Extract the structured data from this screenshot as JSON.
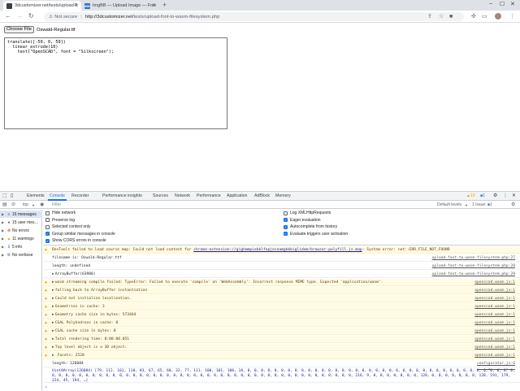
{
  "browser": {
    "tabs": [
      {
        "title": "3dcustomizer.net/tests/upload-font",
        "favicon_color": "#3c4043",
        "fav_text": ""
      },
      {
        "title": "ImgBB — Upload Image — Free",
        "favicon_color": "#2a73c8",
        "fav_text": "IBB"
      }
    ],
    "new_tab": "+",
    "url_warning": "Not secure",
    "url_host": "http://3dcustomizer.net",
    "url_path": "/tests/upload-font-to-wasm-filesystem.php"
  },
  "page": {
    "choose_button": "Choose File",
    "chosen_file": "Oswald-Regular.ttf",
    "code": "translate([-50, 0, 50])\n  linear_extrude(10)\n    text(\"OpenSCAD\", font = \"Silkscreen\");"
  },
  "devtools": {
    "tabs": [
      "Elements",
      "Console",
      "Recorder",
      "Performance insights",
      "Sources",
      "Network",
      "Performance",
      "Application",
      "AdBlock",
      "Memory"
    ],
    "active_tab": "Console",
    "warning_count": "10",
    "info_count": "1",
    "top_context": "top",
    "filter_placeholder": "Filter",
    "default_levels": "Default levels",
    "issues": "1 Issue:",
    "issues_count": "1",
    "sidebar": [
      {
        "label": "16 messages",
        "icon": "≡",
        "color": "#5f6368",
        "selected": true
      },
      {
        "label": "15 user mes…",
        "icon": "●",
        "color": "#5f6368",
        "selected": false
      },
      {
        "label": "No errors",
        "icon": "⊗",
        "color": "#d93025",
        "selected": false
      },
      {
        "label": "11 warnings",
        "icon": "▲",
        "color": "#e8a700",
        "selected": false
      },
      {
        "label": "5 info",
        "icon": "ℹ",
        "color": "#1a73e8",
        "selected": false
      },
      {
        "label": "No verbose",
        "icon": "⚙",
        "color": "#5f6368",
        "selected": false
      }
    ],
    "settings_left": [
      {
        "label": "Hide network",
        "checked": false
      },
      {
        "label": "Preserve log",
        "checked": false
      },
      {
        "label": "Selected context only",
        "checked": false
      },
      {
        "label": "Group similar messages in console",
        "checked": true
      },
      {
        "label": "Show CORS errors in console",
        "checked": true
      }
    ],
    "settings_right": [
      {
        "label": "Log XMLHttpRequests",
        "checked": false
      },
      {
        "label": "Eager evaluation",
        "checked": true
      },
      {
        "label": "Autocomplete from history",
        "checked": true
      },
      {
        "label": "Evaluate triggers user activation",
        "checked": true
      }
    ],
    "console": [
      {
        "kind": "warn",
        "text": "DevTools failed to load source map: Could not load content for ",
        "link": "chrome-extension://gighmmpiobklfepjocnamgkkbiglidom/browser-polyfill.js.map",
        "tail": ": System error: net::ERR_FILE_NOT_FOUND",
        "src": ""
      },
      {
        "kind": "log",
        "text": "filename is: Oswald-Regular.ttf",
        "src": "upload-font-to-wasm-filesystem.php:27"
      },
      {
        "kind": "log",
        "text": "length: undefined",
        "src": "upload-font-to-wasm-filesystem.php:28"
      },
      {
        "kind": "log",
        "caret": true,
        "text": "ArrayBuffer(63980)",
        "src": "upload-font-to-wasm-filesystem.php:29"
      },
      {
        "kind": "warn",
        "caret": true,
        "text": "wasm streaming compile failed: TypeError: Failed to execute 'compile' on 'WebAssembly': Incorrect response MIME type. Expected 'application/wasm'.",
        "src": "openscad.wasm.js:1"
      },
      {
        "kind": "warn",
        "caret": true,
        "text": "falling back to ArrayBuffer instantiation",
        "src": "openscad.wasm.js:1"
      },
      {
        "kind": "warn",
        "caret": true,
        "text": "Could not initialize localization.",
        "src": "openscad.wasm.js:1"
      },
      {
        "kind": "warn",
        "caret": true,
        "text": "Geometries in cache: 3",
        "src": "openscad.wasm.js:1"
      },
      {
        "kind": "warn",
        "caret": true,
        "text": "Geometry cache size in bytes: 573464",
        "src": "openscad.wasm.js:1"
      },
      {
        "kind": "warn",
        "caret": true,
        "text": "CGAL Polyhedrons in cache: 0",
        "src": "openscad.wasm.js:1"
      },
      {
        "kind": "warn",
        "caret": true,
        "text": "CGAL cache size in bytes: 0",
        "src": "openscad.wasm.js:1"
      },
      {
        "kind": "warn",
        "caret": true,
        "text": "Total rendering time: 0:00:00.051",
        "src": "openscad.wasm.js:1"
      },
      {
        "kind": "warn",
        "caret": true,
        "text": "Top level object is a 3D object:",
        "src": "openscad.wasm.js:1"
      },
      {
        "kind": "warn",
        "caret": true,
        "text": "  Facets:       2520",
        "src": "openscad.wasm.js:1"
      },
      {
        "kind": "log",
        "text": "length: 126084",
        "src": "configurator.js:6"
      },
      {
        "kind": "multi",
        "text": "Uint8Array(126084) [79, 112, 101, 110, 83, 67, 65, 68, 32, 77, 111, 100, 101, 108, 10, 0, 0, 0, 0, 0, 0, 0, 0, 0, 0, 0, 0, 0, 0, 0, 0, 0, 0, 0, 0, 0, 0, 0, 0, 0, 0, 0, 0, 0, 0, 0, 0, 0, 0, 0, 0, 0, 0, 0, 0, 0, 0, 0, 0, 0, 0, 0, 0, 0, 0, 0, 0, 0, 0, 0, 0, 0, 0, 0, 0, 0, 0, 0, 0, 0, 0, 0, 0, 0, 0, 0, 0, 0, 0, 0, 0, 0, 0, 0, 0, 0, 0, 0, 0, 0, 216, 9, 0, 0, 0, 0, 0, 0, 0, 128, 0, 0, 0, 0, 0, 0, 0, 128, 191, 179, 224, 45, 194, …]",
        "src": "configurator.js:7"
      }
    ],
    "prompt": "›"
  }
}
